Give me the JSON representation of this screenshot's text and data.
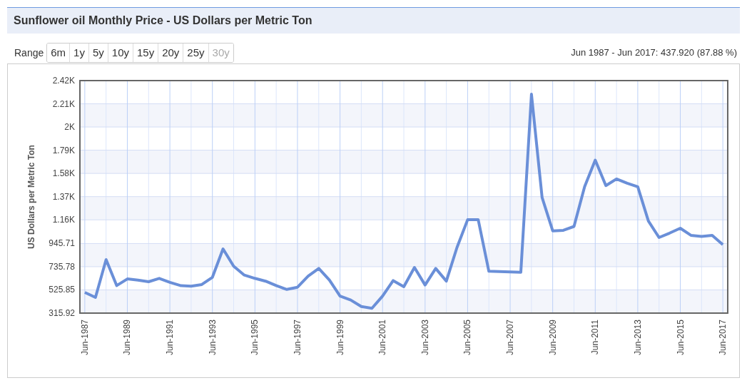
{
  "title": "Sunflower oil Monthly Price - US Dollars per Metric Ton",
  "range": {
    "label": "Range",
    "buttons": [
      {
        "label": "6m",
        "disabled": false
      },
      {
        "label": "1y",
        "disabled": false
      },
      {
        "label": "5y",
        "disabled": false
      },
      {
        "label": "10y",
        "disabled": false
      },
      {
        "label": "15y",
        "disabled": false
      },
      {
        "label": "20y",
        "disabled": false
      },
      {
        "label": "25y",
        "disabled": false
      },
      {
        "label": "30y",
        "disabled": true
      }
    ]
  },
  "summary": "Jun 1987 - Jun 2017: 437.920 (87.88 %)",
  "chart": {
    "chart_data": {
      "type": "line",
      "grid": true,
      "ylabel": "US Dollars per Metric Ton",
      "categories": [
        "Jun-1987",
        null,
        null,
        null,
        "Jun-1989",
        null,
        null,
        null,
        "Jun-1991",
        null,
        null,
        null,
        "Jun-1993",
        null,
        null,
        null,
        "Jun-1995",
        null,
        null,
        null,
        "Jun-1997",
        null,
        null,
        null,
        "Jun-1999",
        null,
        null,
        null,
        "Jun-2001",
        null,
        null,
        null,
        "Jun-2003",
        null,
        null,
        null,
        "Jun-2005",
        null,
        null,
        null,
        "Jun-2007",
        null,
        null,
        null,
        "Jun-2009",
        null,
        null,
        null,
        "Jun-2011",
        null,
        null,
        null,
        "Jun-2013",
        null,
        null,
        null,
        "Jun-2015",
        null,
        null,
        null,
        "Jun-2017"
      ],
      "series": [
        {
          "color": "#6a8fd8",
          "values": [
            503,
            458,
            800,
            565,
            625,
            615,
            600,
            630,
            595,
            565,
            560,
            575,
            640,
            897,
            740,
            660,
            630,
            605,
            565,
            530,
            550,
            650,
            720,
            615,
            470,
            435,
            375,
            360,
            470,
            610,
            555,
            729,
            570,
            720,
            606,
            910,
            1161,
            1161,
            695,
            692,
            689,
            686,
            2297,
            1362,
            1060,
            1065,
            1100,
            1460,
            1700,
            1470,
            1530,
            1491,
            1459,
            1150,
            1000,
            1040,
            1084,
            1020,
            1010,
            1019,
            936
          ]
        }
      ],
      "ylim": [
        315.92,
        2420
      ],
      "yticks": [
        {
          "value": 315.92,
          "label": "315.92"
        },
        {
          "value": 525.85,
          "label": "525.85"
        },
        {
          "value": 735.78,
          "label": "735.78"
        },
        {
          "value": 945.71,
          "label": "945.71"
        },
        {
          "value": 1160,
          "label": "1.16K"
        },
        {
          "value": 1370,
          "label": "1.37K"
        },
        {
          "value": 1580,
          "label": "1.58K"
        },
        {
          "value": 1790,
          "label": "1.79K"
        },
        {
          "value": 2000,
          "label": "2K"
        },
        {
          "value": 2210,
          "label": "2.21K"
        },
        {
          "value": 2420,
          "label": "2.42K"
        }
      ]
    }
  }
}
